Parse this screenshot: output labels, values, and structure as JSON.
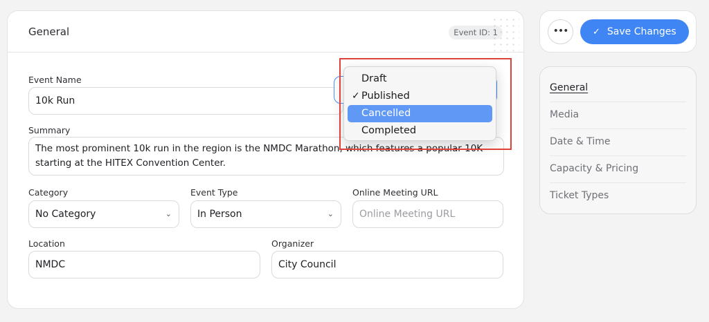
{
  "card": {
    "title": "General",
    "event_id": "Event ID: 1"
  },
  "form": {
    "event_name": {
      "label": "Event Name",
      "value": "10k Run"
    },
    "summary": {
      "label": "Summary",
      "value": "The most prominent 10k run in the region is the NMDC Marathon, which features a popular 10K starting at the HITEX Convention Center."
    },
    "category": {
      "label": "Category",
      "value": "No Category"
    },
    "event_type": {
      "label": "Event Type",
      "value": "In Person"
    },
    "online_url": {
      "label": "Online Meeting URL",
      "placeholder": "Online Meeting URL"
    },
    "location": {
      "label": "Location",
      "value": "NMDC"
    },
    "organizer": {
      "label": "Organizer",
      "value": "City Council"
    }
  },
  "status_dropdown": {
    "options": [
      "Draft",
      "Published",
      "Cancelled",
      "Completed"
    ],
    "checked": "Published",
    "highlighted": "Cancelled"
  },
  "toolbar": {
    "more_label": "•••",
    "save_label": "Save Changes"
  },
  "nav": {
    "items": [
      "General",
      "Media",
      "Date & Time",
      "Capacity & Pricing",
      "Ticket Types"
    ],
    "active": "General"
  },
  "colors": {
    "accent": "#3f86f4",
    "highlight": "#5f98f5",
    "annotation_box": "#e0403a"
  }
}
